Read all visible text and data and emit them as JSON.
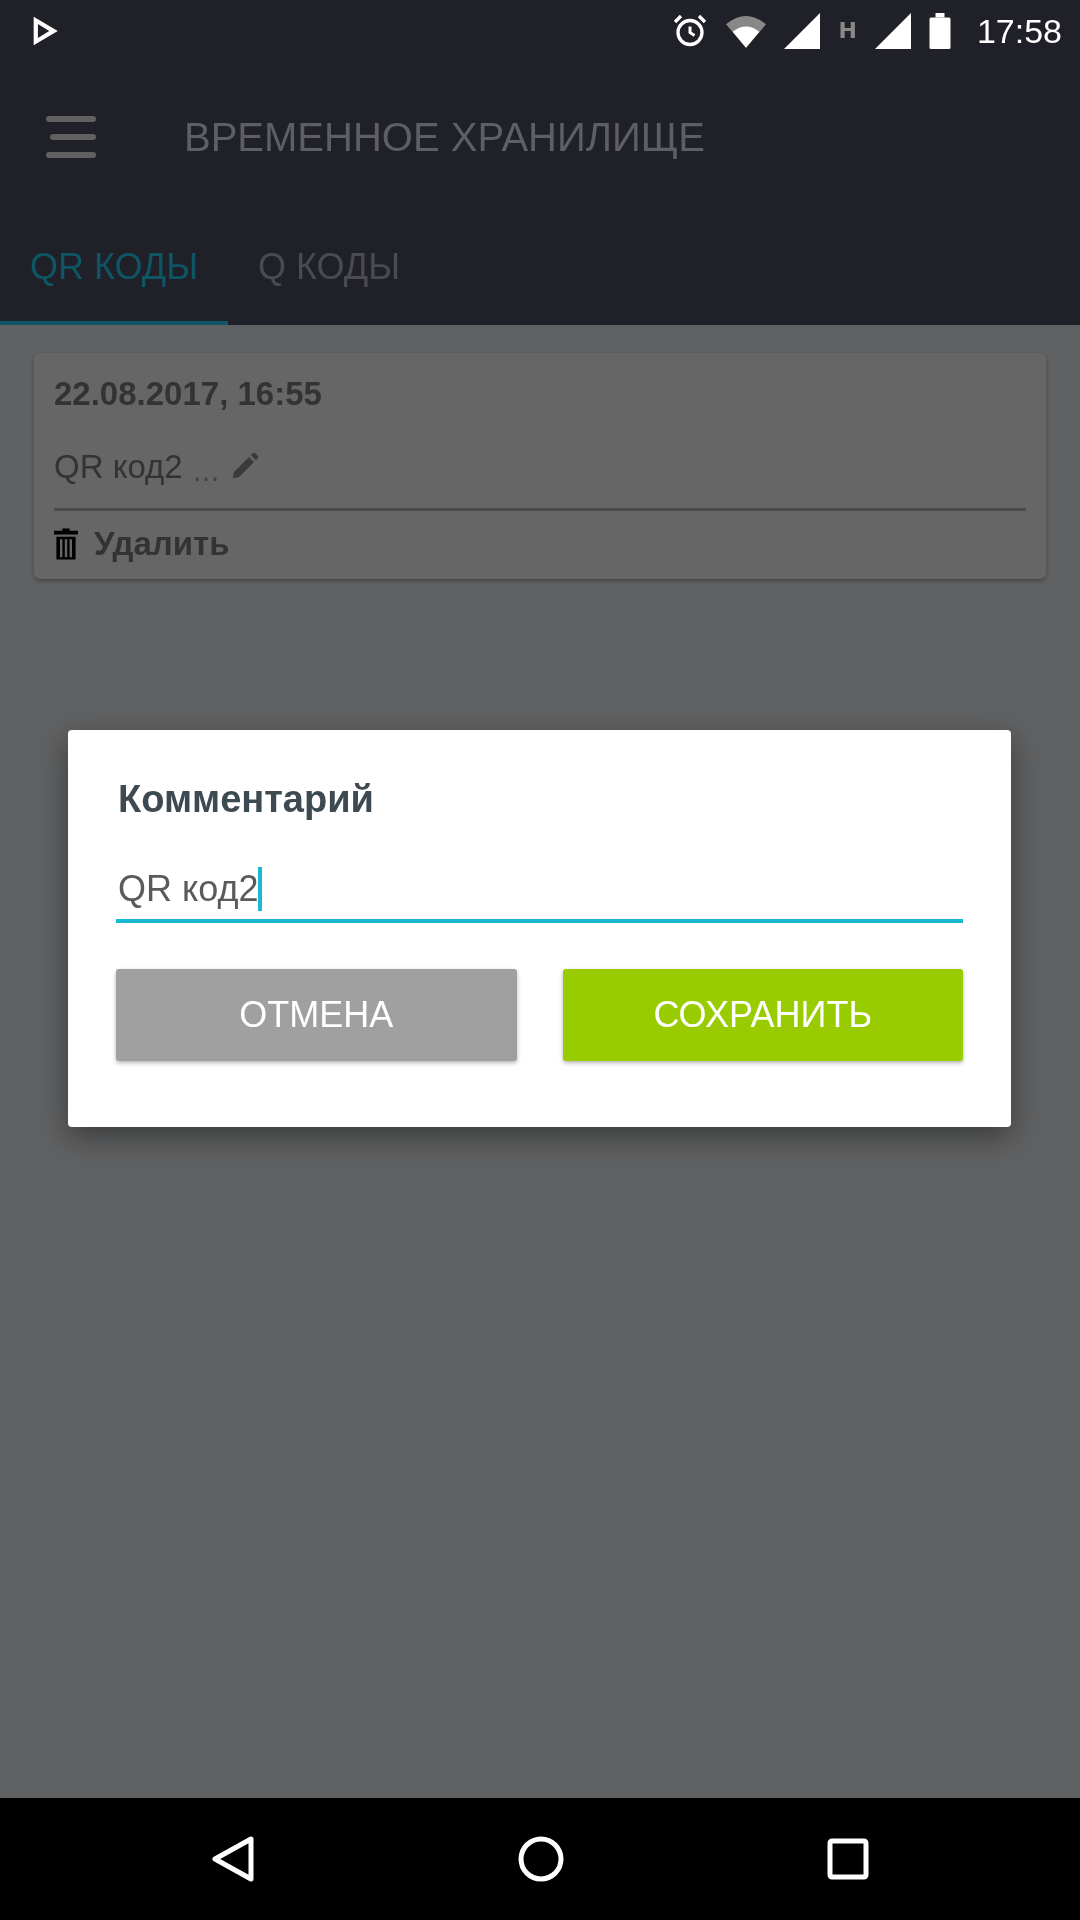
{
  "status_bar": {
    "network_type": "H",
    "time": "17:58"
  },
  "app_bar": {
    "title": "ВРЕМЕННОЕ ХРАНИЛИЩЕ"
  },
  "tabs": [
    {
      "label": "QR КОДЫ",
      "selected": true
    },
    {
      "label": "Q КОДЫ",
      "selected": false
    }
  ],
  "entries": [
    {
      "date": "22.08.2017, 16:55",
      "comment": "QR код2",
      "ellipsis": "...",
      "delete_label": "Удалить"
    }
  ],
  "dialog": {
    "title": "Комментарий",
    "value": "QR код2",
    "focused": true,
    "buttons": [
      {
        "label": "ОТМЕНА",
        "kind": "cancel"
      },
      {
        "label": "СОХРАНИТЬ",
        "kind": "save"
      }
    ]
  }
}
